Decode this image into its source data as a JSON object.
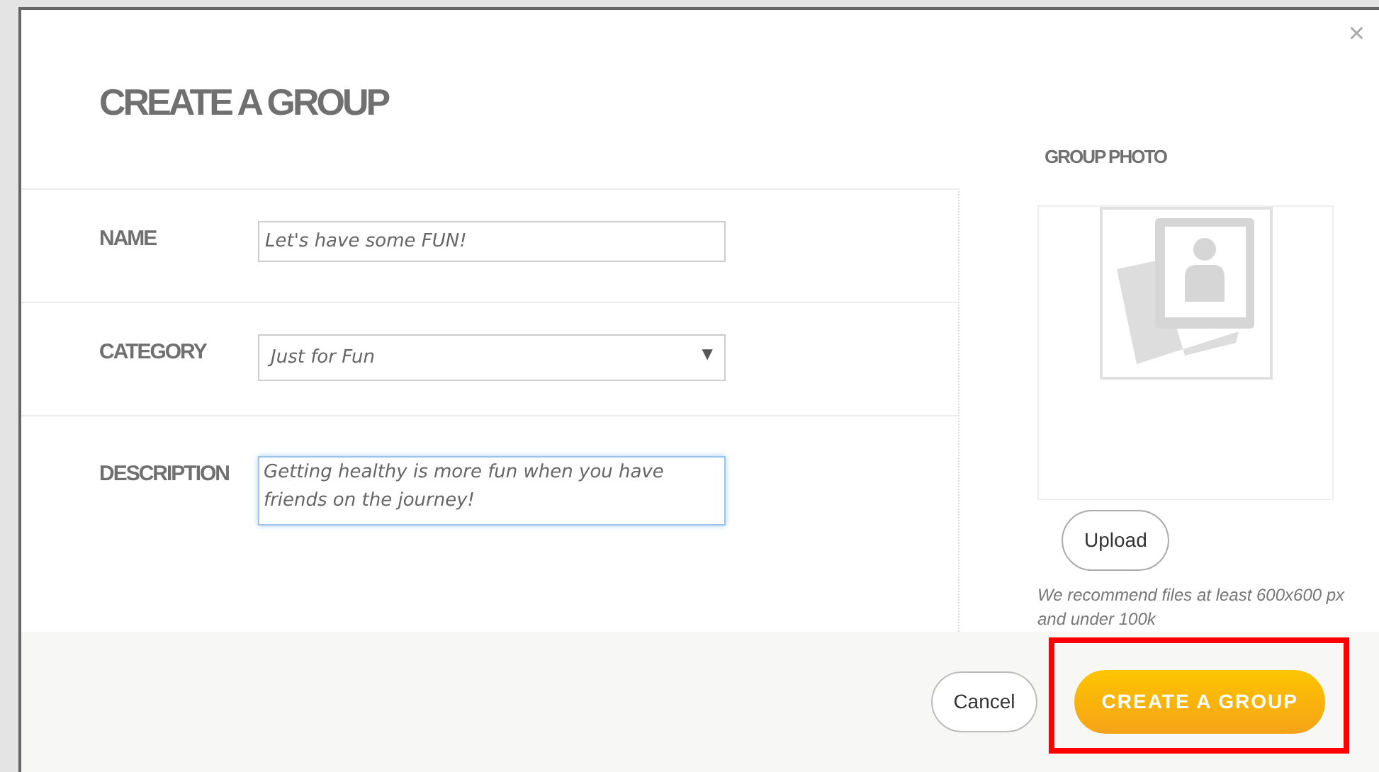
{
  "dialog": {
    "title": "CREATE A GROUP",
    "close": "×"
  },
  "fields": [
    {
      "label": "NAME",
      "kind": "text",
      "value": "Let's have some FUN!",
      "focused": false
    },
    {
      "label": "CATEGORY",
      "kind": "select",
      "value": "Just for Fun",
      "caret": "▼",
      "focused": false
    },
    {
      "label": "DESCRIPTION",
      "kind": "textarea",
      "value": "Getting healthy is more fun when you have friends on the journey!",
      "focused": true
    }
  ],
  "photo": {
    "heading": "GROUP PHOTO",
    "upload": "Upload",
    "hint": "We recommend files at least 600x600 px and under 100k"
  },
  "footer": {
    "cancel": "Cancel",
    "submit": "CREATE A GROUP",
    "submit_highlighted": true
  }
}
